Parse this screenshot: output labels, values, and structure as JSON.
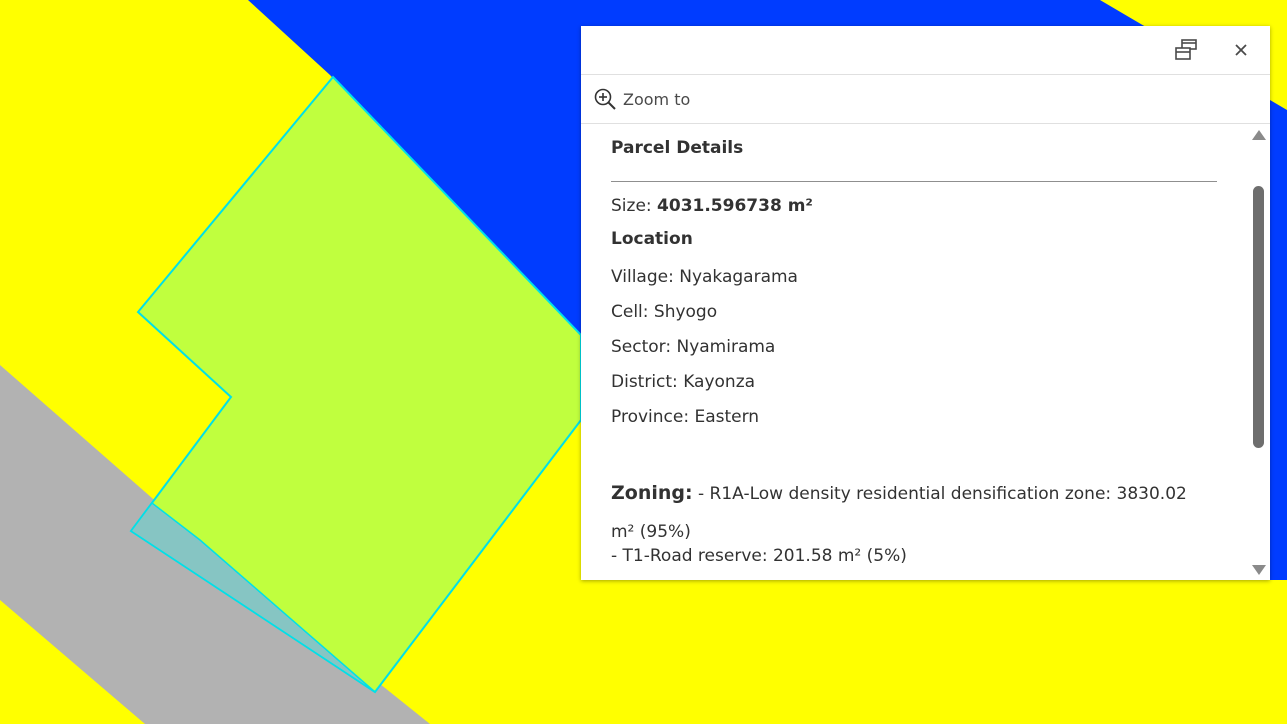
{
  "map": {
    "colors": {
      "background": "#ffff00",
      "water": "#003cff",
      "road": "#b2b2b2",
      "parcel_fill": "#c0ff3e",
      "parcel_outline": "#00e0e8",
      "road_reserve": "#86c5c3"
    }
  },
  "popup": {
    "icons": {
      "dock": "dock-icon",
      "close": "close-icon",
      "zoom": "zoom-in-icon"
    },
    "actions": {
      "zoom_to_label": "Zoom to"
    },
    "title": "Parcel Details",
    "size": {
      "label": "Size:",
      "value": "4031.596738 m²"
    },
    "location": {
      "title": "Location",
      "village": "Village: Nyakagarama",
      "cell": "Cell: Shyogo",
      "sector": "Sector: Nyamirama",
      "district": "District: Kayonza",
      "province": "Province: Eastern"
    },
    "zoning": {
      "label": "Zoning:",
      "line1": "- R1A-Low density residential densification zone: 3830.02 m² (95%)",
      "line2": "- T1-Road reserve: 201.58 m² (5%)"
    }
  }
}
